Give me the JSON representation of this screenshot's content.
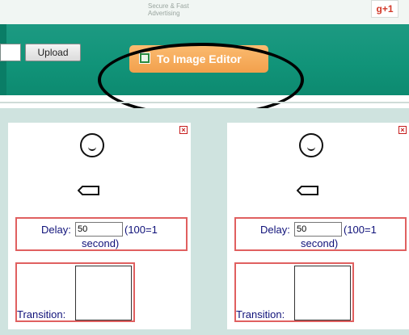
{
  "ad": {
    "line1": "Secure & Fast",
    "line2": "Advertising"
  },
  "gplus": {
    "label": "g+1"
  },
  "toolbar": {
    "upload_label": "Upload",
    "editor_label": "To Image Editor"
  },
  "frames": [
    {
      "delay_label": "Delay:",
      "delay_value": "50",
      "delay_hint_1": "(100=1",
      "delay_hint_2": "second)",
      "transition_label": "Transition:"
    },
    {
      "delay_label": "Delay:",
      "delay_value": "50",
      "delay_hint_1": "(100=1",
      "delay_hint_2": "second)",
      "transition_label": "Transition:"
    }
  ],
  "colors": {
    "header": "#119479",
    "button": "#f4a752",
    "workspace": "#cfe3df",
    "box_border": "#e06060",
    "label_text": "#10127a"
  }
}
